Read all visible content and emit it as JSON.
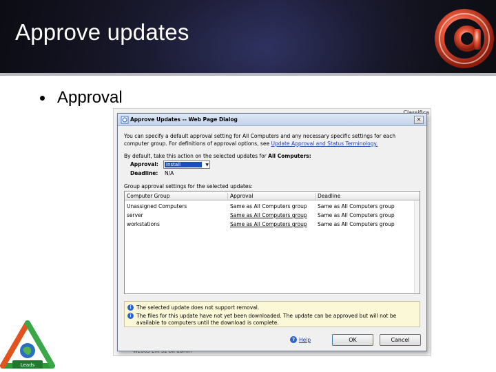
{
  "slide": {
    "title": "Approve updates",
    "bullet": "Approval"
  },
  "background_window": {
    "tab_label": "Classifica",
    "footer_text": "W2003 Ent 32 bit admin"
  },
  "dialog": {
    "title": "Approve Updates -- Web Page Dialog",
    "close_glyph": "×",
    "intro_text": "You can specify a default approval setting for All Computers and any necessary specific settings for each computer group. For definitions of approval options, see",
    "intro_link": "Update Approval and Status Terminology.",
    "default_prefix": "By default, take this action on the selected updates for",
    "default_target": "All Computers:",
    "approval_label": "Approval:",
    "approval_value": "Install",
    "deadline_label": "Deadline:",
    "deadline_value": "N/A",
    "group_settings_label": "Group approval settings for the selected updates:",
    "columns": [
      "Computer Group",
      "Approval",
      "Deadline"
    ],
    "rows": [
      {
        "group": "Unassigned Computers",
        "approval": "Same as All Computers group",
        "deadline": "Same as All Computers group"
      },
      {
        "group": "server",
        "approval": "Same as All Computers group",
        "deadline": "Same as All Computers group"
      },
      {
        "group": "workstations",
        "approval": "Same as All Computers group",
        "deadline": "Same as All Computers group"
      }
    ],
    "info_messages": [
      "The selected update does not support removal.",
      "The files for this update have not yet been downloaded. The update can be approved but will not be available to computers until the download is complete."
    ],
    "help_label": "Help",
    "ok_label": "OK",
    "cancel_label": "Cancel"
  },
  "badge": {
    "text": "Leads"
  },
  "colors": {
    "header_bg": "#141420",
    "title_text": "#ffffff",
    "dialog_bg": "#f0f0f0",
    "link": "#1a3fb0",
    "selection": "#1c4fb8",
    "info_bg": "#fbf8d8"
  }
}
